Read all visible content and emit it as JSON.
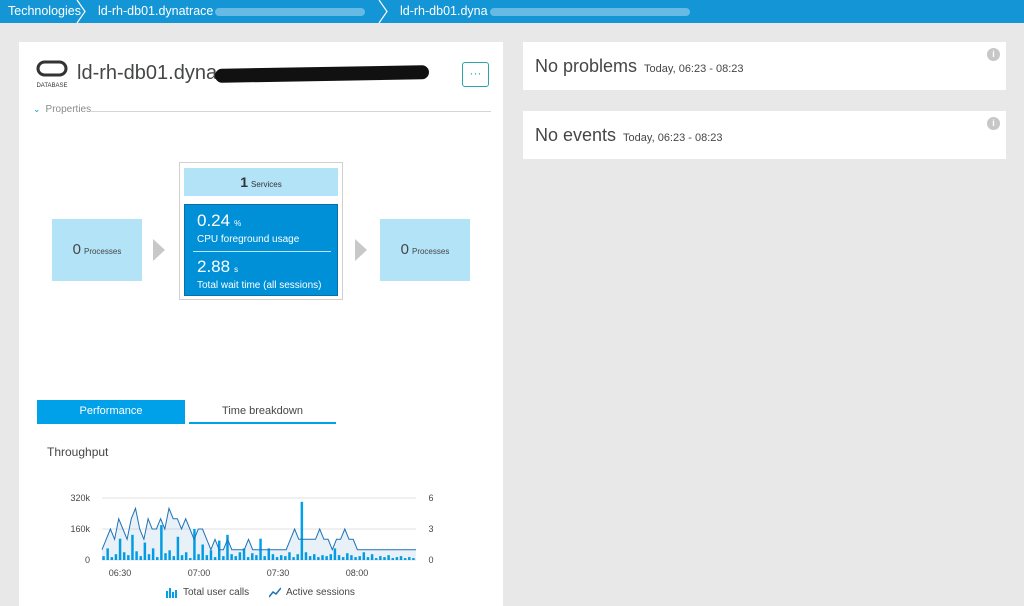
{
  "breadcrumb": {
    "items": [
      {
        "label": "Technologies"
      },
      {
        "label": "ld-rh-db01.dynatrace"
      },
      {
        "label": "ld-rh-db01.dyna"
      }
    ]
  },
  "entity": {
    "icon_label": "DATABASE",
    "title": "ld-rh-db01.dyna",
    "more_label": "···",
    "properties_label": "Properties"
  },
  "flow": {
    "left": {
      "count": "0",
      "label": "Processes"
    },
    "services": {
      "count": "1",
      "label": "Services"
    },
    "cpu": {
      "value": "0.24",
      "unit": "%",
      "label": "CPU foreground usage"
    },
    "wait": {
      "value": "2.88",
      "unit": "s",
      "label": "Total wait time (all sessions)"
    },
    "right": {
      "count": "0",
      "label": "Processes"
    }
  },
  "tabs": [
    {
      "label": "Performance",
      "active": true
    },
    {
      "label": "Time breakdown",
      "active": false
    }
  ],
  "throughput": {
    "title": "Throughput",
    "legend": [
      {
        "label": "Total user calls",
        "icon": "bar-chart-icon"
      },
      {
        "label": "Active sessions",
        "icon": "line-chart-icon"
      }
    ]
  },
  "chart_data": {
    "type": "bar",
    "x_ticks": [
      "06:30",
      "07:00",
      "07:30",
      "08:00"
    ],
    "y_left_ticks": [
      "320k",
      "160k",
      "0"
    ],
    "y_right_ticks": [
      "6",
      "3",
      "0"
    ],
    "ylim_left": [
      0,
      320000
    ],
    "ylim_right": [
      0,
      6
    ],
    "series": [
      {
        "name": "Total user calls",
        "kind": "bar",
        "axis": "left",
        "values": [
          20000,
          60000,
          15000,
          30000,
          110000,
          40000,
          25000,
          130000,
          45000,
          20000,
          90000,
          30000,
          60000,
          15000,
          180000,
          35000,
          50000,
          20000,
          120000,
          25000,
          40000,
          10000,
          160000,
          30000,
          80000,
          25000,
          50000,
          15000,
          100000,
          20000,
          130000,
          30000,
          20000,
          40000,
          60000,
          15000,
          35000,
          25000,
          110000,
          20000,
          60000,
          30000,
          15000,
          25000,
          20000,
          40000,
          15000,
          30000,
          300000,
          40000,
          20000,
          30000,
          15000,
          25000,
          20000,
          30000,
          60000,
          25000,
          15000,
          35000,
          25000,
          15000,
          20000,
          40000,
          15000,
          30000,
          10000,
          20000,
          15000,
          25000,
          10000,
          15000,
          20000,
          10000,
          15000,
          10000
        ]
      },
      {
        "name": "Active sessions",
        "kind": "line",
        "axis": "right",
        "values": [
          1,
          2,
          3,
          2,
          4,
          3,
          2,
          4,
          5,
          3,
          2,
          4,
          3,
          3,
          4,
          3,
          5,
          4,
          4,
          3,
          4,
          3,
          2,
          3,
          3,
          2,
          1,
          2,
          1,
          1,
          2,
          1,
          1,
          1,
          1,
          2,
          1,
          1,
          1,
          1,
          1,
          1,
          1,
          1,
          1,
          2,
          3,
          2,
          2,
          2,
          2,
          2,
          3,
          2,
          2,
          1,
          2,
          2,
          3,
          2,
          2,
          1,
          1,
          1,
          1,
          1,
          1,
          1,
          1,
          1,
          1,
          1,
          1,
          1,
          1,
          1
        ]
      }
    ]
  },
  "cards": [
    {
      "title": "No problems",
      "time": "Today, 06:23 - 08:23"
    },
    {
      "title": "No events",
      "time": "Today, 06:23 - 08:23"
    }
  ],
  "colors": {
    "accent": "#00a1e9",
    "header": "#1496d6",
    "service_box": "#b3e3f7",
    "db_box": "#0090d8"
  }
}
